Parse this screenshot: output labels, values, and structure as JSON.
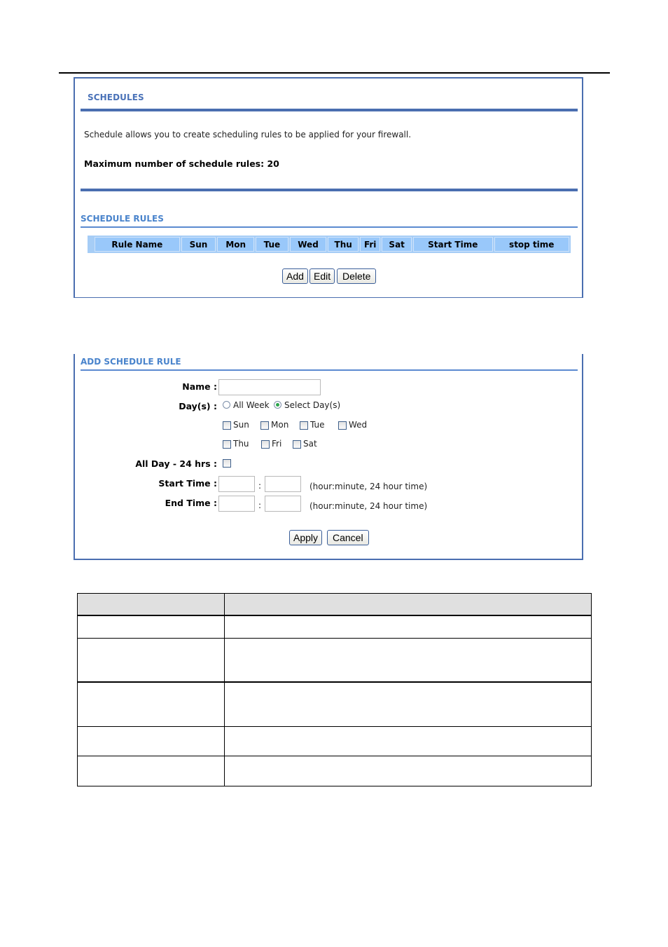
{
  "schedules": {
    "title": "SCHEDULES",
    "description": "Schedule allows you to create scheduling rules to be applied for your firewall.",
    "max_rules_text": "Maximum number of schedule rules: 20",
    "rules_section_title": "SCHEDULE RULES",
    "table_headers": [
      "Rule Name",
      "Sun",
      "Mon",
      "Tue",
      "Wed",
      "Thu",
      "Fri",
      "Sat",
      "Start Time",
      "stop time"
    ],
    "rows": [],
    "buttons": {
      "add": "Add",
      "edit": "Edit",
      "delete": "Delete"
    }
  },
  "add_rule": {
    "title": "ADD SCHEDULE RULE",
    "name_label": "Name :",
    "name_value": "",
    "days_label": "Day(s) :",
    "day_mode_options": [
      {
        "label": "All Week",
        "selected": false
      },
      {
        "label": "Select Day(s)",
        "selected": true
      }
    ],
    "days": [
      {
        "label": "Sun",
        "checked": false
      },
      {
        "label": "Mon",
        "checked": false
      },
      {
        "label": "Tue",
        "checked": false
      },
      {
        "label": "Wed",
        "checked": false
      },
      {
        "label": "Thu",
        "checked": false
      },
      {
        "label": "Fri",
        "checked": false
      },
      {
        "label": "Sat",
        "checked": false
      }
    ],
    "all_day_label": "All Day - 24 hrs :",
    "all_day_checked": false,
    "start_time_label": "Start Time :",
    "end_time_label": "End Time :",
    "time_separator": ":",
    "time_hint": "(hour:minute, 24 hour time)",
    "start_hour": "",
    "start_minute": "",
    "end_hour": "",
    "end_minute": "",
    "buttons": {
      "apply": "Apply",
      "cancel": "Cancel"
    }
  },
  "doc_table": {
    "headers": [
      "",
      ""
    ],
    "rows": [
      [
        "",
        ""
      ],
      [
        "",
        ""
      ],
      [
        "",
        ""
      ],
      [
        "",
        ""
      ],
      [
        "",
        ""
      ]
    ]
  }
}
